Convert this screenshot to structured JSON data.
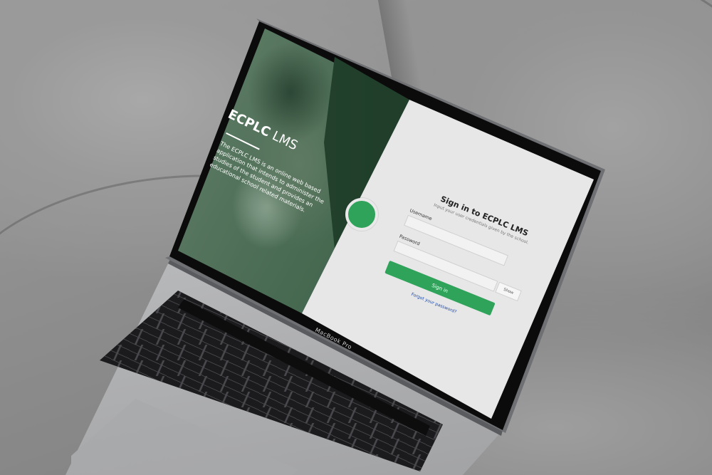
{
  "device": {
    "model_label": "MacBook Pro"
  },
  "hero": {
    "title_bold": "ECPLC",
    "title_light": " LMS",
    "description": "The ECPLC LMS is an online web based application that intends to administer the studies of the student and provides an educational school related materials."
  },
  "signin": {
    "title": "Sign in to ECPLC LMS",
    "subtitle": "Input your user credentials given by the school.",
    "username_label": "Username",
    "username_value": "",
    "password_label": "Password",
    "password_value": "",
    "show_label": "Show",
    "submit_label": "Sign in",
    "forgot_label": "Forgot your password?"
  },
  "colors": {
    "accent": "#2fa35a",
    "panel_bg": "#e7e7e7",
    "link": "#1f4aa8"
  }
}
